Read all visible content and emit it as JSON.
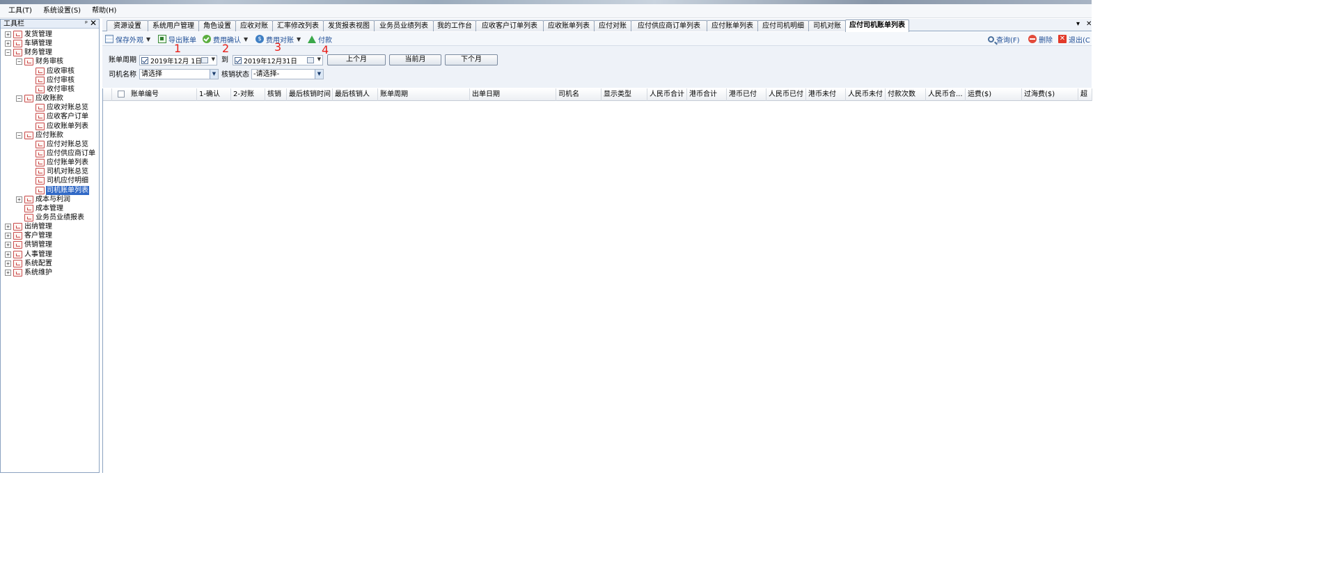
{
  "menu": [
    "工具(T)",
    "系统设置(S)",
    "帮助(H)"
  ],
  "sidebar": {
    "title": "工具栏",
    "pin_glyph": "ᵖ",
    "close_glyph": "✕",
    "nodes": [
      {
        "label": "发货管理",
        "level": 0,
        "exp": "+",
        "icon": "document-icon"
      },
      {
        "label": "车辆管理",
        "level": 0,
        "exp": "+",
        "icon": "truck-icon"
      },
      {
        "label": "财务管理",
        "level": 0,
        "exp": "−",
        "icon": "finance-icon"
      },
      {
        "label": "财务审核",
        "level": 1,
        "exp": "−",
        "icon": "audit-icon"
      },
      {
        "label": "应收审核",
        "level": 2,
        "exp": "",
        "icon": "receivable-audit-icon"
      },
      {
        "label": "应付审核",
        "level": 2,
        "exp": "",
        "icon": "payable-audit-icon"
      },
      {
        "label": "收付审核",
        "level": 2,
        "exp": "",
        "icon": "payment-audit-icon"
      },
      {
        "label": "应收账款",
        "level": 1,
        "exp": "−",
        "icon": "receivable-icon"
      },
      {
        "label": "应收对账总览",
        "level": 2,
        "exp": "",
        "icon": "statement-icon"
      },
      {
        "label": "应收客户订单",
        "level": 2,
        "exp": "",
        "icon": "order-icon"
      },
      {
        "label": "应收账单列表",
        "level": 2,
        "exp": "",
        "icon": "bill-list-icon"
      },
      {
        "label": "应付账款",
        "level": 1,
        "exp": "−",
        "icon": "payable-icon"
      },
      {
        "label": "应付对账总览",
        "level": 2,
        "exp": "",
        "icon": "statement-icon"
      },
      {
        "label": "应付供应商订单",
        "level": 2,
        "exp": "",
        "icon": "supplier-order-icon"
      },
      {
        "label": "应付账单列表",
        "level": 2,
        "exp": "",
        "icon": "bill-list-icon"
      },
      {
        "label": "司机对账总览",
        "level": 2,
        "exp": "",
        "icon": "driver-statement-icon"
      },
      {
        "label": "司机应付明细",
        "level": 2,
        "exp": "",
        "icon": "driver-detail-icon"
      },
      {
        "label": "司机账单列表",
        "level": 2,
        "exp": "",
        "icon": "driver-bill-icon",
        "selected": true
      },
      {
        "label": "成本与利润",
        "level": 1,
        "exp": "+",
        "icon": "profit-chart-icon"
      },
      {
        "label": "成本管理",
        "level": 1,
        "exp": "",
        "icon": "cost-icon"
      },
      {
        "label": "业务员业绩报表",
        "level": 1,
        "exp": "",
        "icon": "report-icon"
      },
      {
        "label": "出纳管理",
        "level": 0,
        "exp": "+",
        "icon": "cashier-icon"
      },
      {
        "label": "客户管理",
        "level": 0,
        "exp": "+",
        "icon": "customer-icon"
      },
      {
        "label": "供销管理",
        "level": 0,
        "exp": "+",
        "icon": "supply-icon"
      },
      {
        "label": "人事管理",
        "level": 0,
        "exp": "+",
        "icon": "people-icon"
      },
      {
        "label": "系统配置",
        "level": 0,
        "exp": "+",
        "icon": "config-icon"
      },
      {
        "label": "系统维护",
        "level": 0,
        "exp": "+",
        "icon": "monitor-icon"
      }
    ]
  },
  "tabs": [
    {
      "label": "资源设置"
    },
    {
      "label": "系统用户管理"
    },
    {
      "label": "角色设置"
    },
    {
      "label": "应收对账"
    },
    {
      "label": "汇率修改列表"
    },
    {
      "label": "发货报表视图"
    },
    {
      "label": "业务员业绩列表"
    },
    {
      "label": "我的工作台"
    },
    {
      "label": "应收客户订单列表"
    },
    {
      "label": "应收账单列表"
    },
    {
      "label": "应付对账"
    },
    {
      "label": "应付供应商订单列表"
    },
    {
      "label": "应付账单列表"
    },
    {
      "label": "应付司机明细"
    },
    {
      "label": "司机对账"
    },
    {
      "label": "应付司机账单列表",
      "active": true
    }
  ],
  "tab_controls": {
    "menu": "▾",
    "close": "✕"
  },
  "toolbar": {
    "save_view": "保存外观",
    "export": "导出账单",
    "confirm": "费用确认",
    "reconcile": "费用对账",
    "pay": "付款",
    "query": "查询(F)",
    "delete": "删除",
    "exit": "退出(C"
  },
  "filter": {
    "period_label": "账单周期",
    "date_from": "2019年12月 1日",
    "to_label": "到",
    "date_to": "2019年12月31日",
    "prev_month": "上个月",
    "this_month": "当前月",
    "next_month": "下个月",
    "driver_label": "司机名称",
    "driver_value": "请选择",
    "status_label": "核销状态",
    "status_value": "-请选择-"
  },
  "annotations": [
    "1",
    "2",
    "3",
    "4"
  ],
  "grid": {
    "columns": [
      "账单编号",
      "1-确认",
      "2-对账",
      "核销",
      "最后核销时间",
      "最后核销人",
      "账单周期",
      "出单日期",
      "司机名",
      "显示类型",
      "人民币合计",
      "港币合计",
      "港币已付",
      "人民币已付",
      "港币未付",
      "人民币未付",
      "付款次数",
      "人民币合...",
      "运费($)",
      "过海费($)",
      "超"
    ]
  },
  "colors": {
    "selection": "#3169c6",
    "annotation": "#e8201a",
    "accent": "#1f4e96"
  }
}
